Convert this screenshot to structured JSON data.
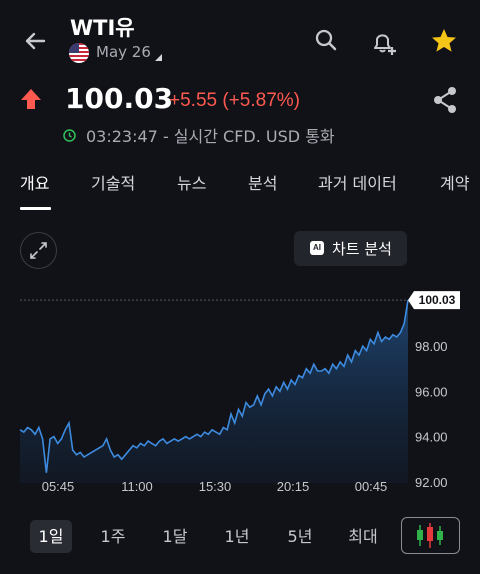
{
  "header": {
    "title": "WTI유",
    "date": "May 26"
  },
  "quote": {
    "price": "100.03",
    "change": "+5.55 (+5.87%)",
    "status": "03:23:47 - 실시간 CFD. USD 통화",
    "direction_color": "#ff5a4f"
  },
  "tabs": [
    "개요",
    "기술적",
    "뉴스",
    "분석",
    "과거 데이터",
    "계약"
  ],
  "chart_button_label": "차트 분석",
  "ai_badge": "AI",
  "ranges": [
    "1일",
    "1주",
    "1달",
    "1년",
    "5년",
    "최대"
  ],
  "colors": {
    "background": "#111218",
    "accent_up": "#ff5a4f",
    "line": "#3d8be0",
    "star": "#f5c518"
  },
  "chart_data": {
    "type": "area",
    "x_tick_labels": [
      "05:45",
      "11:00",
      "15:30",
      "20:15",
      "00:45"
    ],
    "y_tick_labels": [
      "92.00",
      "94.00",
      "96.00",
      "98.00"
    ],
    "last_price_label": "100.03",
    "ylim": [
      91.95,
      100.3
    ],
    "values": [
      94.3,
      94.2,
      94.4,
      94.3,
      94.1,
      94.4,
      93.9,
      92.4,
      93.9,
      94,
      93.7,
      93.9,
      94.3,
      94.6,
      93.4,
      93.2,
      93.3,
      93.1,
      93.2,
      93.3,
      93.4,
      93.5,
      93.6,
      93.9,
      93.4,
      93.1,
      93.2,
      93.0,
      93.2,
      93.4,
      93.6,
      93.5,
      93.7,
      93.6,
      93.8,
      93.7,
      93.6,
      93.8,
      93.9,
      93.7,
      93.8,
      93.9,
      93.8,
      93.9,
      94.0,
      93.9,
      94.0,
      94.1,
      94.0,
      94.2,
      94.1,
      94.3,
      94.2,
      94.1,
      94.4,
      94.3,
      95.0,
      94.6,
      95.2,
      94.9,
      95.5,
      95.3,
      95.4,
      95.8,
      95.4,
      95.9,
      96.1,
      95.8,
      96.2,
      96.0,
      96.4,
      96.1,
      96.5,
      96.3,
      96.7,
      96.6,
      97.0,
      96.8,
      97.2,
      96.9,
      96.9,
      97.0,
      96.8,
      97.2,
      97.0,
      97.3,
      97.1,
      97.6,
      97.3,
      97.8,
      97.6,
      98.0,
      97.8,
      98.3,
      98.1,
      98.6,
      98.2,
      98.4,
      98.3,
      98.5,
      98.4,
      98.6,
      99.0,
      100.03
    ]
  }
}
